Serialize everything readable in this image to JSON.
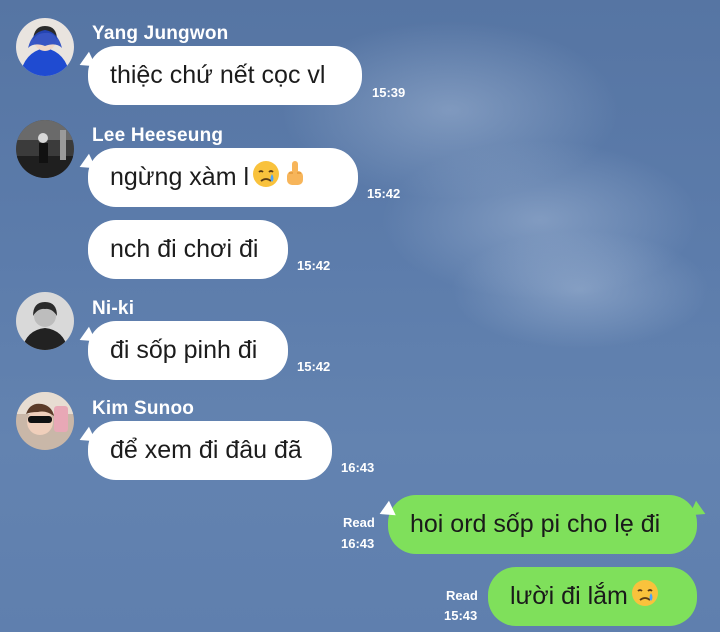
{
  "messages": [
    {
      "sender": "Yang Jungwon",
      "text": "thiệc chứ nết cọc vl",
      "time": "15:39"
    },
    {
      "sender": "Lee Heeseung",
      "text": "ngừng xàm l",
      "time": "15:42",
      "emoji": [
        "crying-face-icon",
        "middle-finger-icon"
      ]
    },
    {
      "sender": "",
      "text": "nch đi chơi đi",
      "time": "15:42"
    },
    {
      "sender": "Ni-ki",
      "text": "đi sốp pinh đi",
      "time": "15:42"
    },
    {
      "sender": "Kim Sunoo",
      "text": "để xem đi đâu đã",
      "time": "16:43"
    },
    {
      "sender": "me",
      "text": "hoi ord sốp pi cho lẹ đi",
      "time": "16:43",
      "status": "Read"
    },
    {
      "sender": "me",
      "text": "lười đi lắm",
      "time": "15:43",
      "status": "Read",
      "emoji": [
        "crying-face-icon"
      ]
    }
  ],
  "colors": {
    "background": "#5c7cab",
    "incoming": "#ffffff",
    "outgoing": "#7fe05b"
  }
}
